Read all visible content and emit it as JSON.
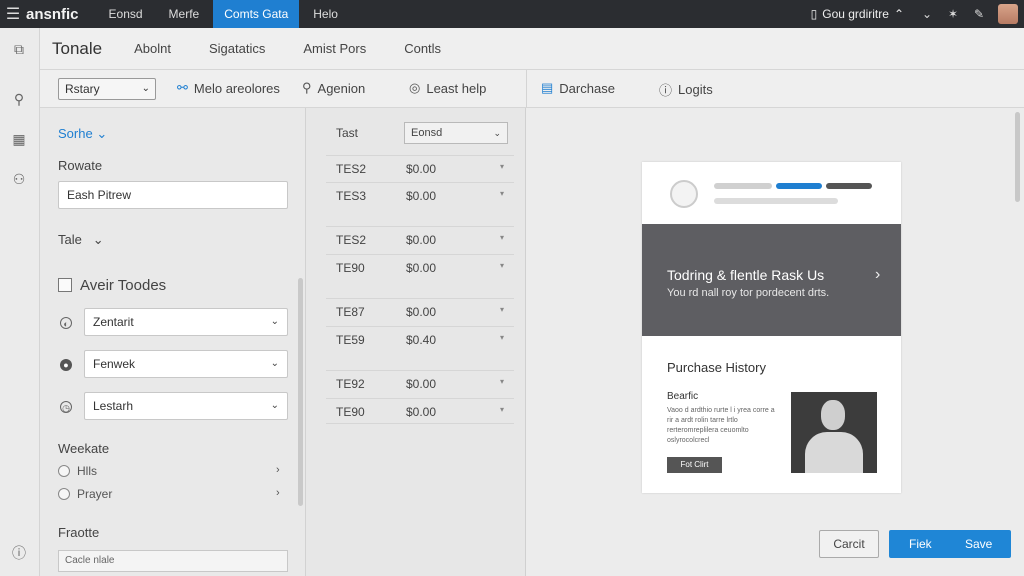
{
  "topbar": {
    "brand": "ansnfic",
    "tabs": [
      {
        "label": "Eonsd"
      },
      {
        "label": "Merfe"
      },
      {
        "label": "Comts Gata"
      },
      {
        "label": "Helo"
      }
    ],
    "account": "Gou grdiritre",
    "accent_color": "#1f7fd1"
  },
  "header": {
    "title": "Tonale",
    "nav": [
      "Abolnt",
      "Sigatatics",
      "Amist Pors",
      "Contls"
    ]
  },
  "toolbar": {
    "dropdown": "Rstary",
    "items": [
      "Melo areolores",
      "Agenion",
      "Least help"
    ],
    "right_items": [
      "Darchase",
      "Logits"
    ]
  },
  "left_panel": {
    "section_link": "Sorhe",
    "field_label": "Rowate",
    "field_value": "Eash Pitrew",
    "tale_label": "Tale",
    "checkbox_label": "Aveir Toodes",
    "selects": [
      "Zentarit",
      "Fenwek",
      "Lestarh"
    ],
    "group_label": "Weekate",
    "radios": [
      "Hlls",
      "Prayer"
    ],
    "footer_label": "Fraotte",
    "footer_input": "Cacle nlale"
  },
  "middle_panel": {
    "header": "Tast",
    "select": "Eonsd",
    "rows": [
      {
        "code": "TES2",
        "amount": "$0.00"
      },
      {
        "code": "TES3",
        "amount": "$0.00"
      },
      {
        "code": "TES2",
        "amount": "$0.00"
      },
      {
        "code": "TE90",
        "amount": "$0.00"
      },
      {
        "code": "TE87",
        "amount": "$0.00"
      },
      {
        "code": "TE59",
        "amount": "$0.40"
      },
      {
        "code": "TE92",
        "amount": "$0.00"
      },
      {
        "code": "TE90",
        "amount": "$0.00"
      }
    ]
  },
  "preview": {
    "hero_title": "Todring & flentle Rask Us",
    "hero_sub": "You rd nall roy tor pordecent drts.",
    "section_title": "Purchase History",
    "product_title": "Bearfic",
    "product_desc": "Vaoo d ardthio rurte l i yrea corre a rir a ardt rolin tarre lrtlo rerteromreplilera ceuomlto oslyrocolcrecl",
    "product_button": "Fot Clirt",
    "bar_colors": [
      "#d0d0d0",
      "#1f7fd1",
      "#555555"
    ]
  },
  "actions": {
    "cancel": "Carcit",
    "primary_left": "Fiek",
    "primary_right": "Save"
  }
}
